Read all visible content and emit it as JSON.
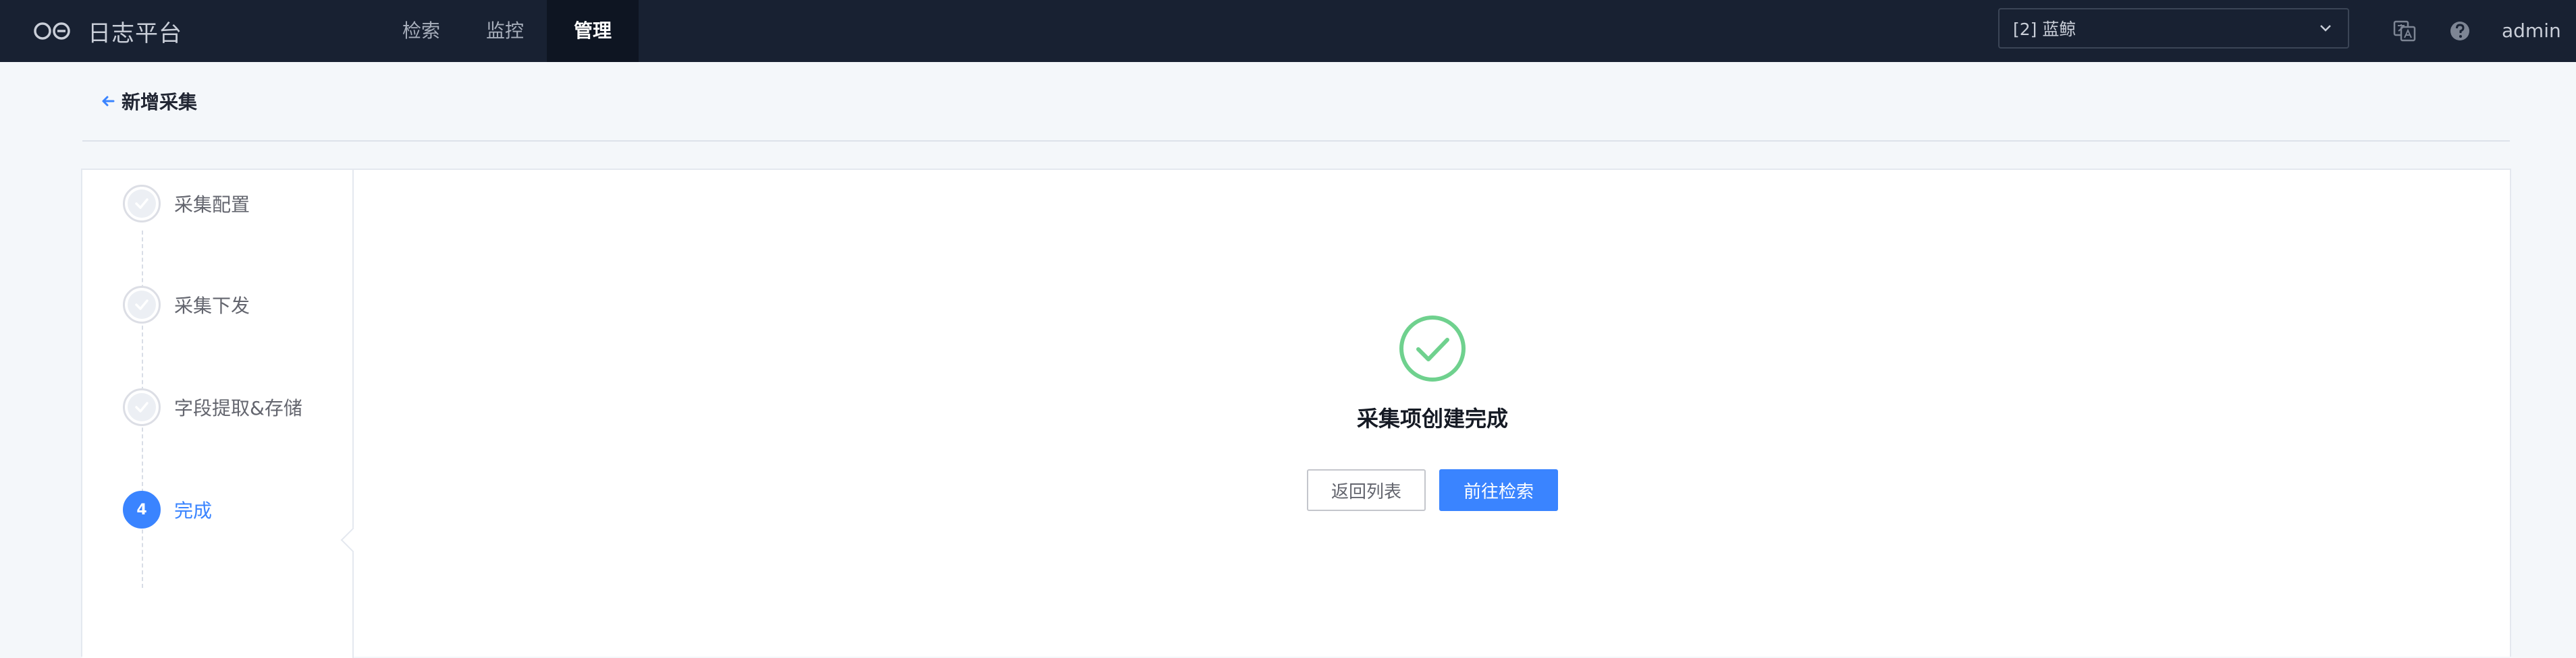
{
  "app": {
    "name": "日志平台",
    "logo_icon": "infinity-logo-icon"
  },
  "nav": {
    "items": [
      {
        "label": "检索",
        "active": false
      },
      {
        "label": "监控",
        "active": false
      },
      {
        "label": "管理",
        "active": true
      }
    ]
  },
  "business_selector": {
    "value": "[2] 蓝鲸",
    "icon": "chevron-down-icon"
  },
  "header_icons": {
    "language": "language-icon",
    "help": "help-icon"
  },
  "user": {
    "name": "admin"
  },
  "page": {
    "title": "新增采集",
    "back_icon": "arrow-left-icon"
  },
  "steps": [
    {
      "label": "采集配置",
      "state": "done"
    },
    {
      "label": "采集下发",
      "state": "done"
    },
    {
      "label": "字段提取&存储",
      "state": "done"
    },
    {
      "label": "完成",
      "number": "4",
      "state": "current"
    }
  ],
  "result": {
    "icon": "check-circle-icon",
    "message": "采集项创建完成",
    "buttons": {
      "back_to_list": "返回列表",
      "go_search": "前往检索"
    }
  },
  "colors": {
    "topbar": "#182132",
    "primary": "#3a84ff",
    "success": "#6fd18e",
    "page_bg": "#f4f7fa"
  }
}
